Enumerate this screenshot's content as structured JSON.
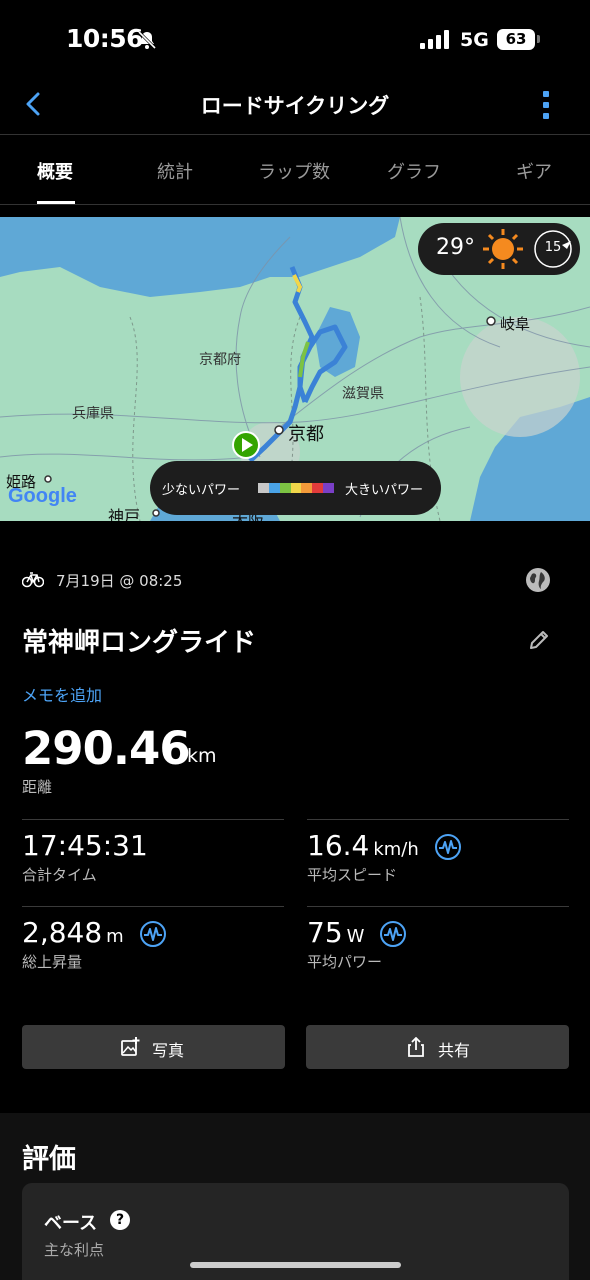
{
  "status_bar": {
    "time": "10:56",
    "network": "5G",
    "battery": "63",
    "icons": [
      "bell-slash-icon",
      "signal-icon",
      "battery-icon"
    ]
  },
  "header": {
    "title": "ロードサイクリング",
    "back_icon": "chevron-left-icon",
    "more_icon": "vertical-dots-icon"
  },
  "tabs": [
    {
      "label": "概要",
      "active": true
    },
    {
      "label": "統計",
      "active": false
    },
    {
      "label": "ラップ数",
      "active": false
    },
    {
      "label": "グラフ",
      "active": false
    },
    {
      "label": "ギア",
      "active": false
    }
  ],
  "map": {
    "labels": {
      "kyoto_pref": "京都府",
      "hyogo": "兵庫県",
      "shiga": "滋賀県",
      "gifu": "岐阜",
      "kyoto": "京都",
      "himeji": "姫路",
      "kobe": "神戸",
      "osaka": "大阪"
    },
    "attribution": "Google",
    "weather": {
      "temperature": "29°",
      "wind_speed": "15",
      "icon": "sun-icon"
    },
    "legend": {
      "low": "少ないパワー",
      "high": "大きいパワー",
      "colors": [
        "#c7c7c7",
        "#4aa3e6",
        "#7cc343",
        "#f0d64a",
        "#f39a3a",
        "#e23b3b",
        "#7a3fc7"
      ]
    },
    "accent": "#3b82d6"
  },
  "activity": {
    "date": "7月19日 @ 08:25",
    "name": "常神岬ロングライド",
    "add_memo": "メモを追加",
    "distance": {
      "value": "290.46",
      "unit": "km",
      "label": "距離"
    },
    "stats": [
      {
        "value": "17:45:31",
        "unit": "",
        "label": "合計タイム",
        "has_icon": false
      },
      {
        "value": "16.4",
        "unit": "km/h",
        "label": "平均スピード",
        "has_icon": true
      },
      {
        "value": "2,848",
        "unit": "m",
        "label": "総上昇量",
        "has_icon": true
      },
      {
        "value": "75",
        "unit": "W",
        "label": "平均パワー",
        "has_icon": true
      }
    ]
  },
  "buttons": {
    "photo": "写真",
    "share": "共有"
  },
  "rating": {
    "title": "評価",
    "card_label": "ベース",
    "card_sub": "主な利点",
    "help": "?"
  },
  "colors": {
    "link": "#4da3f5",
    "pulse": "#4da3f5",
    "background": "#000000"
  }
}
